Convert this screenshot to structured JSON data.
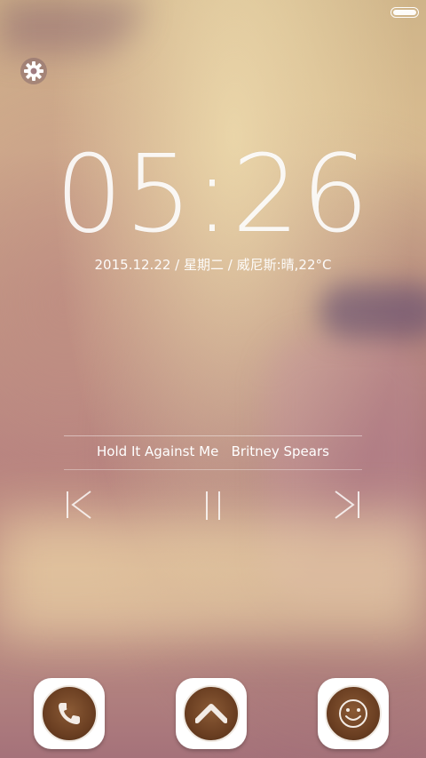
{
  "status": {
    "battery_icon": "battery-full-icon"
  },
  "settings": {
    "icon": "gear-icon"
  },
  "clock": {
    "time": "05:26"
  },
  "date_line": {
    "text": "2015.12.22  / 星期二 / 威尼斯:晴,22°C"
  },
  "music": {
    "track": "Hold It Against Me   Britney Spears",
    "controls": [
      "previous-icon",
      "pause-icon",
      "next-icon"
    ]
  },
  "dock": {
    "items": [
      {
        "name": "phone",
        "icon": "phone-icon"
      },
      {
        "name": "unlock",
        "icon": "chevron-up-icon"
      },
      {
        "name": "smile",
        "icon": "smiley-icon"
      }
    ]
  },
  "colors": {
    "text": "#ffffff",
    "cup_brown": "#6b3f22"
  }
}
